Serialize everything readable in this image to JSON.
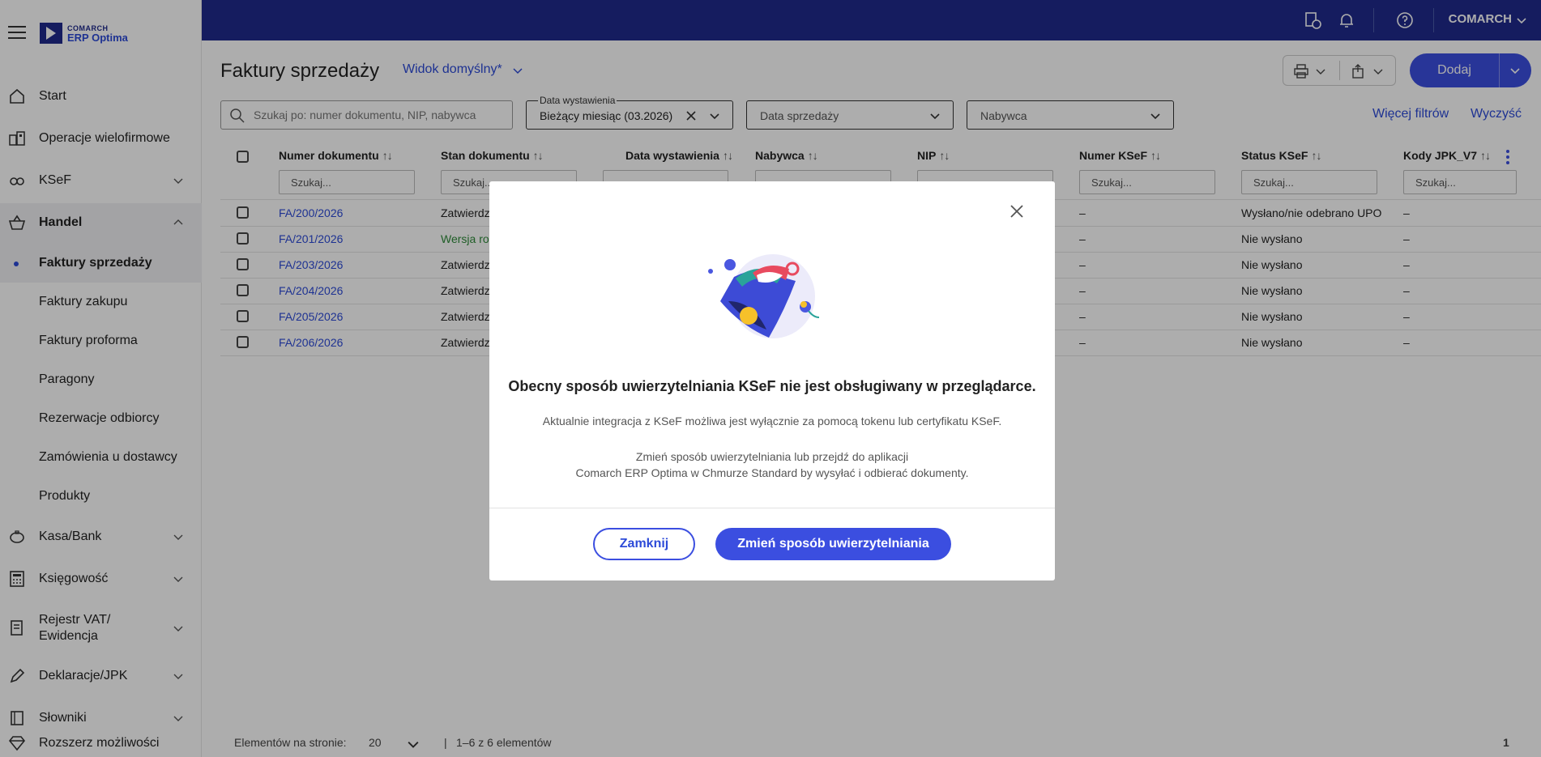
{
  "app": {
    "logo_top": "COMARCH",
    "logo_bottom": "ERP Optima",
    "user": "COMARCH"
  },
  "sidebar": {
    "items": [
      {
        "label": "Start",
        "icon": "home-icon"
      },
      {
        "label": "Operacje wielofirmowe",
        "icon": "multi-company-icon"
      },
      {
        "label": "KSeF",
        "icon": "ksef-icon"
      },
      {
        "label": "Handel",
        "icon": "basket-icon"
      },
      {
        "label": "Kasa/Bank",
        "icon": "piggy-bank-icon"
      },
      {
        "label": "Księgowość",
        "icon": "calculator-icon"
      },
      {
        "label": "Rejestr VAT/",
        "label2": "Ewidencja",
        "icon": "register-icon"
      },
      {
        "label": "Deklaracje/JPK",
        "icon": "pen-icon"
      },
      {
        "label": "Słowniki",
        "icon": "dictionary-icon"
      },
      {
        "label": "Rozszerz możliwości",
        "icon": "diamond-icon"
      }
    ],
    "sub_items": [
      "Faktury sprzedaży",
      "Faktury zakupu",
      "Faktury proforma",
      "Paragony",
      "Rezerwacje odbiorcy",
      "Zamówienia u dostawcy",
      "Produkty"
    ]
  },
  "main": {
    "title": "Faktury sprzedaży",
    "view": "Widok domyślny*",
    "add_label": "Dodaj",
    "search_placeholder": "Szukaj po: numer dokumentu, NIP, nabywca",
    "filter_date_legend": "Data wystawienia",
    "filter_date_value": "Bieżący miesiąc (03.2026)",
    "filter_sale_date": "Data sprzedaży",
    "filter_buyer": "Nabywca",
    "more_filters": "Więcej filtrów",
    "clear": "Wyczyść"
  },
  "table": {
    "headers": [
      "Numer dokumentu",
      "Stan dokumentu",
      "Data wystawienia",
      "Nabywca",
      "NIP",
      "Numer KSeF",
      "Status KSeF",
      "Kody JPK_V7"
    ],
    "filter_placeholder": "Szukaj...",
    "rows": [
      {
        "num": "FA/200/2026",
        "state": "Zatwierdz",
        "ksef": "–",
        "status": "Wysłano/nie odebrano UPO",
        "jpk": "–"
      },
      {
        "num": "FA/201/2026",
        "state": "Wersja ro",
        "ksef": "–",
        "status": "Nie wysłano",
        "jpk": "–"
      },
      {
        "num": "FA/203/2026",
        "state": "Zatwierdz",
        "ksef": "–",
        "status": "Nie wysłano",
        "jpk": "–"
      },
      {
        "num": "FA/204/2026",
        "state": "Zatwierdz",
        "ksef": "–",
        "status": "Nie wysłano",
        "jpk": "–"
      },
      {
        "num": "FA/205/2026",
        "state": "Zatwierdz",
        "ksef": "–",
        "status": "Nie wysłano",
        "jpk": "–"
      },
      {
        "num": "FA/206/2026",
        "state": "Zatwierdz",
        "ksef": "–",
        "status": "Nie wysłano",
        "jpk": "–"
      }
    ]
  },
  "pager": {
    "per_page_label": "Elementów na stronie:",
    "per_page": "20",
    "range": "1–6 z 6 elementów",
    "page": "1"
  },
  "modal": {
    "title": "Obecny sposób uwierzytelniania KSeF nie jest obsługiwany w przeglądarce.",
    "p1": "Aktualnie integracja z KSeF możliwa jest wyłącznie za pomocą tokenu lub certyfikatu KSeF.",
    "p2": "Zmień sposób uwierzytelniania lub przejdź do aplikacji",
    "p3": "Comarch ERP Optima w Chmurze Standard by wysyłać i odbierać dokumenty.",
    "close_label": "Zamknij",
    "change_label": "Zmień sposób uwierzytelniania"
  },
  "colors": {
    "brand": "#1f2a8c",
    "accent": "#3b4ee0",
    "link": "#2d4bd8"
  }
}
